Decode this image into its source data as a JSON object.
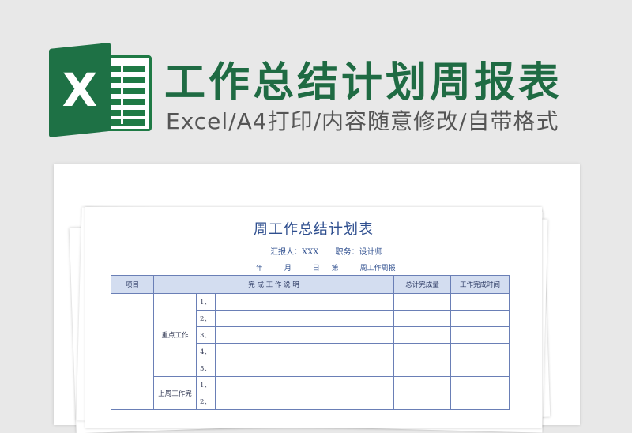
{
  "banner": {
    "logo_letter": "X",
    "title": "工作总结计划周报表",
    "subtitle": "Excel/A4打印/内容随意修改/自带格式"
  },
  "sheet": {
    "title": "周工作总结计划表",
    "reporter_label": "汇报人：XXX",
    "position_label": "职务：设计师",
    "date": {
      "year": "年",
      "month": "月",
      "day": "日",
      "week": "第",
      "report": "周工作周报"
    },
    "headers": [
      "项目",
      "完 成 工 作 说 明",
      "总计完成量",
      "工作完成时间"
    ],
    "sections": [
      {
        "label": "重点工作",
        "rows": [
          "1、",
          "2、",
          "3、",
          "4、",
          "5、"
        ]
      },
      {
        "label": "上周工作完",
        "rows": [
          "1、",
          "2、"
        ]
      }
    ]
  },
  "colors": {
    "brand_green": "#1e7145",
    "title_green": "#1f6b43",
    "sheet_blue": "#2f4f8f",
    "header_fill": "#d3ddf0"
  }
}
